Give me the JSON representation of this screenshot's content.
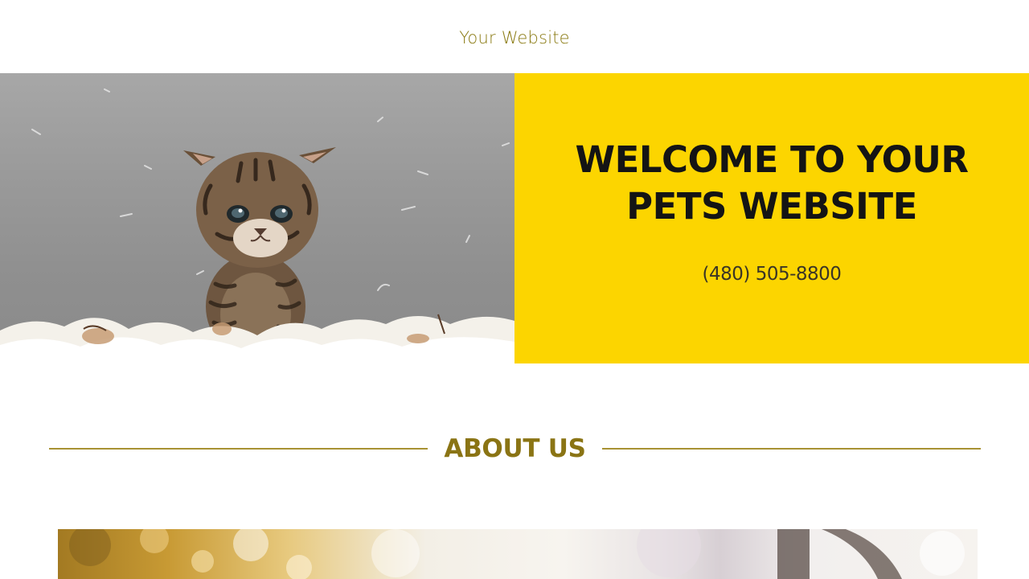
{
  "header": {
    "site_title": "Your Website"
  },
  "hero": {
    "heading_line1": "WELCOME TO YOUR",
    "heading_line2": "PETS WEBSITE",
    "phone": "(480) 505-8800",
    "image_subject": "kitten-in-feathers"
  },
  "about": {
    "title": "ABOUT US",
    "image_subject": "blurred-autumn-scene"
  },
  "colors": {
    "accent_yellow": "#fcd500",
    "brand_gold": "#8a7414",
    "rule_gold": "#a89233",
    "heading_dark": "#141414"
  }
}
